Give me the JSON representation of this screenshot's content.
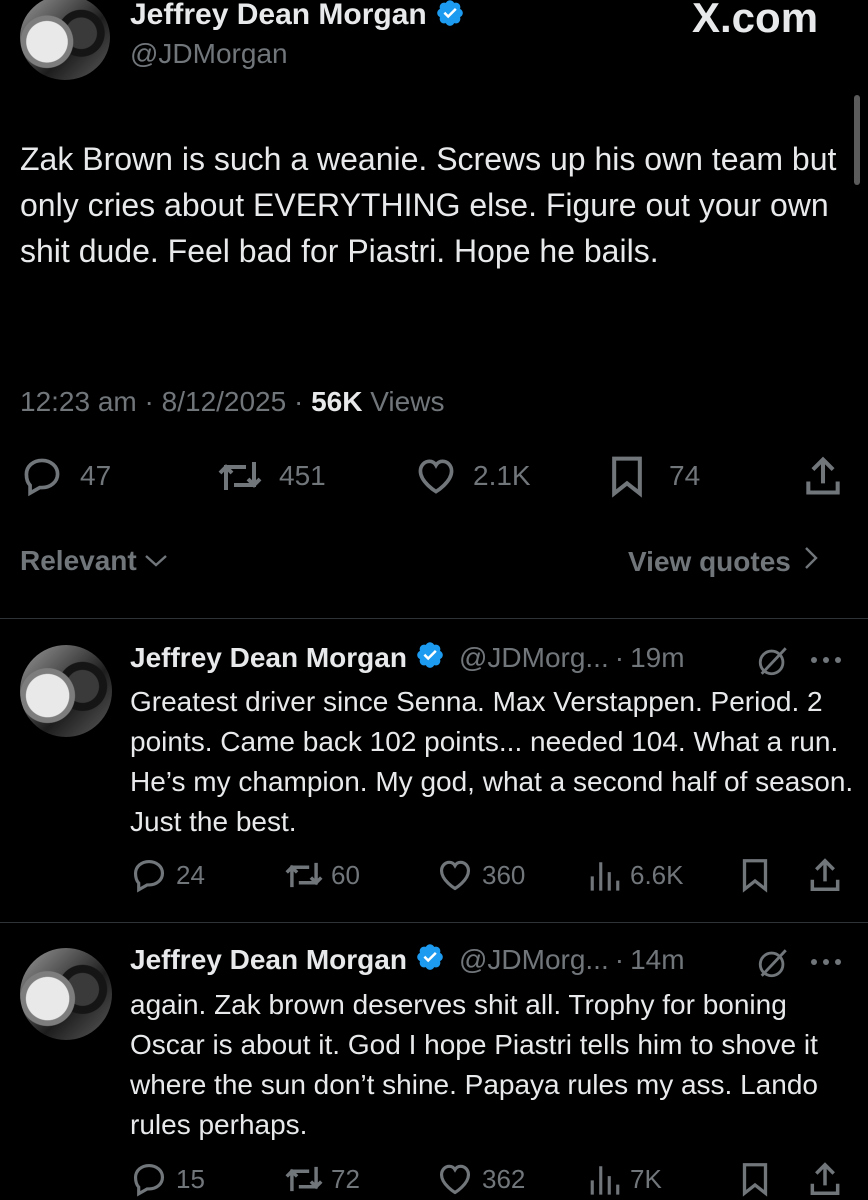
{
  "watermark": "X.com",
  "main_tweet": {
    "author_name": "Jeffrey Dean Morgan",
    "handle": "@JDMorgan",
    "text": "Zak Brown is such a weanie. Screws up his own team but only cries about EVERYTHING else. Figure out your own shit dude. Feel bad for Piastri. Hope he bails.",
    "time": "12:23 am",
    "date": "8/12/2025",
    "views_count": "56K",
    "views_label": "Views",
    "replies": "47",
    "reposts": "451",
    "likes": "2.1K",
    "bookmarks": "74"
  },
  "sort_label": "Relevant",
  "view_quotes_label": "View quotes",
  "replies": [
    {
      "author_name": "Jeffrey Dean Morgan",
      "handle": "@JDMorg...",
      "time": "19m",
      "text": "Greatest driver since Senna. Max Verstappen. Period. 2 points. Came back 102 points... needed 104. What a run. He’s my champion. My god, what a second half of season. Just the best.",
      "replies": "24",
      "reposts": "60",
      "likes": "360",
      "views": "6.6K"
    },
    {
      "author_name": "Jeffrey Dean Morgan",
      "handle": "@JDMorg...",
      "time": "14m",
      "text": "again. Zak brown deserves shit all. Trophy for boning Oscar is about it. God I hope Piastri tells him to shove it where the sun don’t shine. Papaya rules my ass. Lando rules perhaps.",
      "replies": "15",
      "reposts": "72",
      "likes": "362",
      "views": "7K"
    }
  ],
  "colors": {
    "background": "#000000",
    "text": "#e7e9ea",
    "muted": "#71767b",
    "verified": "#1d9bf0",
    "divider": "#2f3336"
  }
}
